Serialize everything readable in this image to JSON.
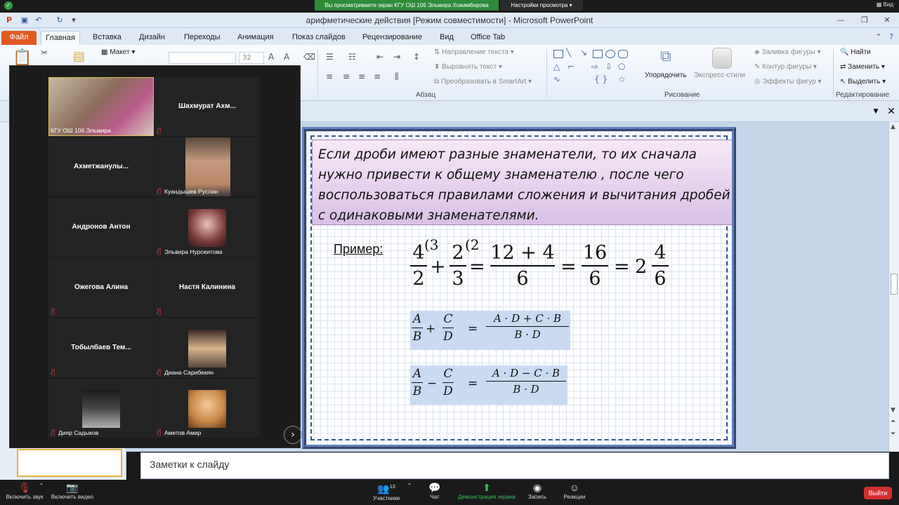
{
  "zoom_top": {
    "share_banner": "Вы просматриваете экран КГУ ОШ 106 Эльмира Хожамбирова",
    "view_options": "Настройки просмотра",
    "view_label": "Вид"
  },
  "ppt": {
    "title": "арифметические действия [Режим совместимости]  -  Microsoft PowerPoint",
    "tabs": [
      "Файл",
      "Главная",
      "Вставка",
      "Дизайн",
      "Переходы",
      "Анимация",
      "Показ слайдов",
      "Рецензирование",
      "Вид",
      "Office Tab"
    ],
    "ribbon": {
      "layout_label": "Макет",
      "font_size": "32",
      "text_direction": "Направление текста",
      "align_text": "Выровнять текст",
      "smartart": "Преобразовать в SmartArt",
      "paragraph_group": "Абзац",
      "arrange": "Упорядочить",
      "quick_styles": "Экспресс-стили",
      "shape_fill": "Заливка фигуры",
      "shape_outline": "Контур фигуры",
      "shape_effects": "Эффекты фигур",
      "drawing_group": "Рисование",
      "find": "Найти",
      "replace": "Заменить",
      "select": "Выделить",
      "editing_group": "Редактирование"
    },
    "slide": {
      "rule_text": "Если дроби имеют разные знаменатели, то их сначала нужно привести к общему знаменателю , после чего воспользоваться правилами сложения и вычитания дробей с одинаковыми знаменателями.",
      "example_label": "Пример:",
      "example": {
        "f1_num": "4",
        "f1_den": "2",
        "f1_mult": "(3",
        "plus": "+",
        "f2_num": "2",
        "f2_den": "3",
        "f2_mult": "(2",
        "eq": "=",
        "f3_num": "12 + 4",
        "f3_den": "6",
        "f4_num": "16",
        "f4_den": "6",
        "whole": "2",
        "f5_num": "4",
        "f5_den": "6"
      },
      "formula_add": {
        "a": "A",
        "b": "B",
        "op": "+",
        "c": "C",
        "d": "D",
        "eq": "=",
        "num": "A · D + C · B",
        "den": "B · D"
      },
      "formula_sub": {
        "a": "A",
        "b": "B",
        "op": "−",
        "c": "C",
        "d": "D",
        "eq": "=",
        "num": "A · D − C · B",
        "den": "B · D"
      }
    },
    "notes_placeholder": "Заметки к слайду"
  },
  "participants": [
    {
      "name": "КГУ ОШ 106 Эльмира",
      "video": true
    },
    {
      "name": "Шахмурат  Ахм...",
      "video": false
    },
    {
      "name": "Ахметжанулы...",
      "video": false
    },
    {
      "name": "Куандышев Руслан",
      "video": true
    },
    {
      "name": "Андронов Антон",
      "video": false
    },
    {
      "name": "Эльвира Нурсеитова",
      "video": true
    },
    {
      "name": "Ожегова Алина",
      "video": false
    },
    {
      "name": "Настя Калинина",
      "video": false
    },
    {
      "name": "Тобылбаев  Тем...",
      "video": false
    },
    {
      "name": "Диана Сарибекян",
      "video": true
    },
    {
      "name": "Дияр Садыков",
      "video": true
    },
    {
      "name": "Аметов Амир",
      "video": true
    }
  ],
  "zoom_bottom": {
    "unmute": "Включить звук",
    "start_video": "Включить видео",
    "participants": "Участники",
    "participants_count": "13",
    "chat": "Чат",
    "share_screen": "Демонстрация экрана",
    "record": "Запись",
    "reactions": "Реакции",
    "leave": "Выйти"
  },
  "colors": {
    "file_tab": "#e05a1f",
    "share_green": "#2e8b3a",
    "leave_red": "#d32f2f",
    "formula_bg": "#c9daf2"
  }
}
